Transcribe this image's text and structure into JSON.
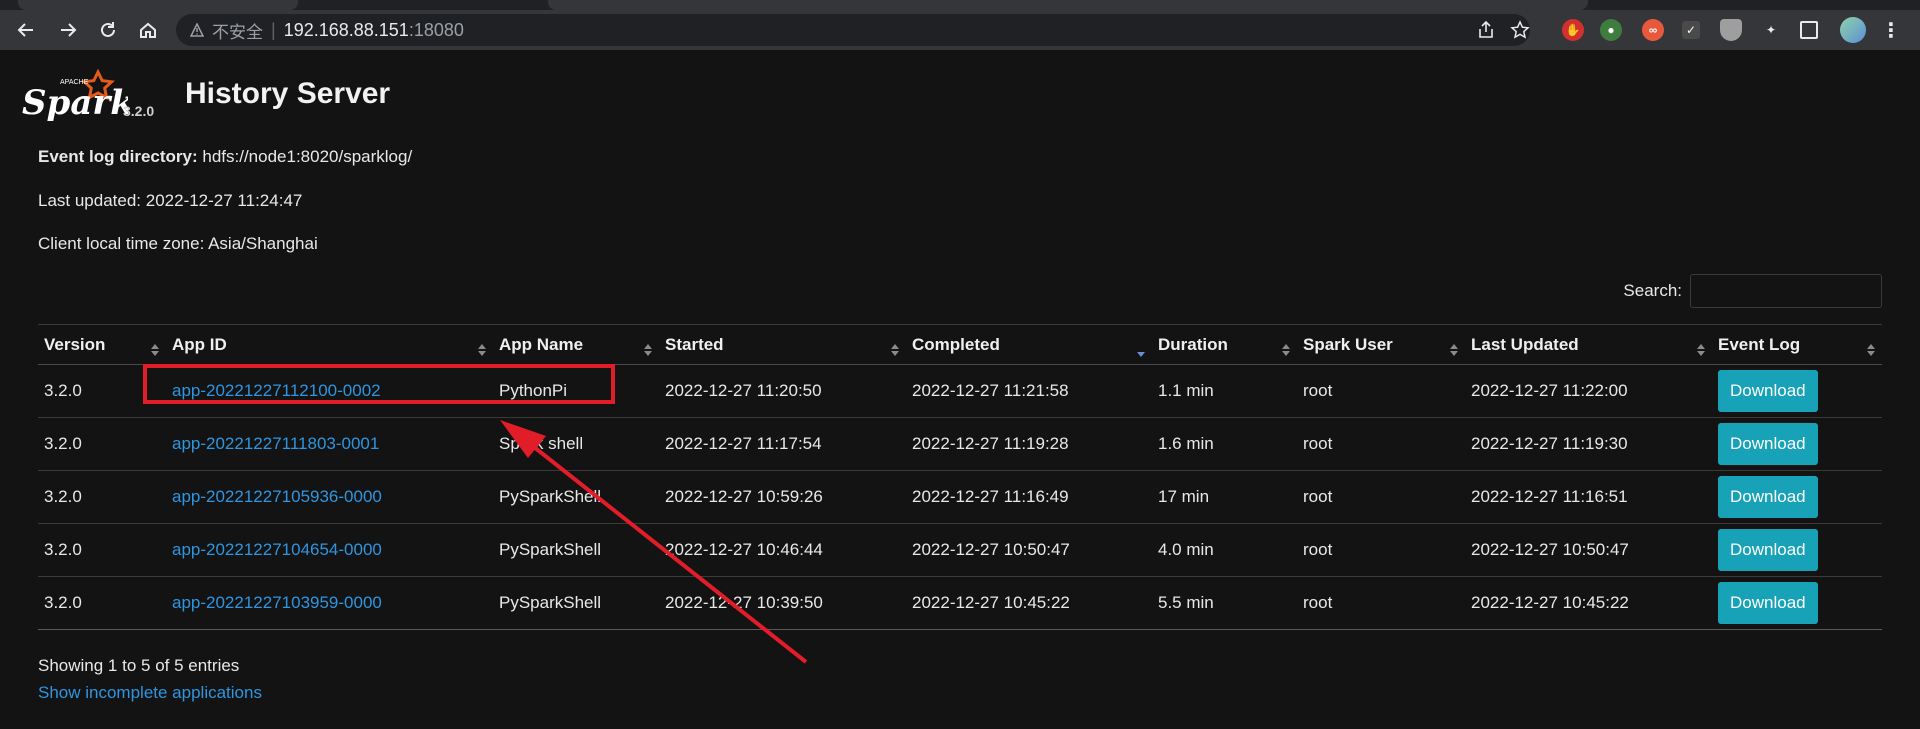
{
  "browser": {
    "address_warning": "不安全",
    "address_separator": "|",
    "address_host": "192.168.88.151",
    "address_port": ":18080"
  },
  "header": {
    "logo_small": "APACHE",
    "logo_text": "Spark",
    "spark_version": "3.2.0",
    "title": "History Server"
  },
  "info": {
    "event_log_label": "Event log directory:",
    "event_log_value": "hdfs://node1:8020/sparklog/",
    "last_updated": "Last updated: 2022-12-27 11:24:47",
    "timezone": "Client local time zone: Asia/Shanghai"
  },
  "search": {
    "label": "Search:",
    "value": ""
  },
  "table": {
    "columns": [
      "Version",
      "App ID",
      "App Name",
      "Started",
      "Completed",
      "Duration",
      "Spark User",
      "Last Updated",
      "Event Log"
    ],
    "sorted_column": "Completed",
    "sort_direction": "descending",
    "rows": [
      {
        "version": "3.2.0",
        "app_id": "app-20221227112100-0002",
        "app_name": "PythonPi",
        "started": "2022-12-27 11:20:50",
        "completed": "2022-12-27 11:21:58",
        "duration": "1.1 min",
        "user": "root",
        "last_updated": "2022-12-27 11:22:00",
        "event_log": "Download"
      },
      {
        "version": "3.2.0",
        "app_id": "app-20221227111803-0001",
        "app_name": "Spark shell",
        "started": "2022-12-27 11:17:54",
        "completed": "2022-12-27 11:19:28",
        "duration": "1.6 min",
        "user": "root",
        "last_updated": "2022-12-27 11:19:30",
        "event_log": "Download"
      },
      {
        "version": "3.2.0",
        "app_id": "app-20221227105936-0000",
        "app_name": "PySparkShell",
        "started": "2022-12-27 10:59:26",
        "completed": "2022-12-27 11:16:49",
        "duration": "17 min",
        "user": "root",
        "last_updated": "2022-12-27 11:16:51",
        "event_log": "Download"
      },
      {
        "version": "3.2.0",
        "app_id": "app-20221227104654-0000",
        "app_name": "PySparkShell",
        "started": "2022-12-27 10:46:44",
        "completed": "2022-12-27 10:50:47",
        "duration": "4.0 min",
        "user": "root",
        "last_updated": "2022-12-27 10:50:47",
        "event_log": "Download"
      },
      {
        "version": "3.2.0",
        "app_id": "app-20221227103959-0000",
        "app_name": "PySparkShell",
        "started": "2022-12-27 10:39:50",
        "completed": "2022-12-27 10:45:22",
        "duration": "5.5 min",
        "user": "root",
        "last_updated": "2022-12-27 10:45:22",
        "event_log": "Download"
      }
    ]
  },
  "footer": {
    "showing": "Showing 1 to 5 of 5 entries",
    "incomplete_link": "Show incomplete applications"
  },
  "colors": {
    "background": "#131313",
    "link": "#2f95e0",
    "download_button": "#17a2b8",
    "annotation": "#e11d2a"
  }
}
